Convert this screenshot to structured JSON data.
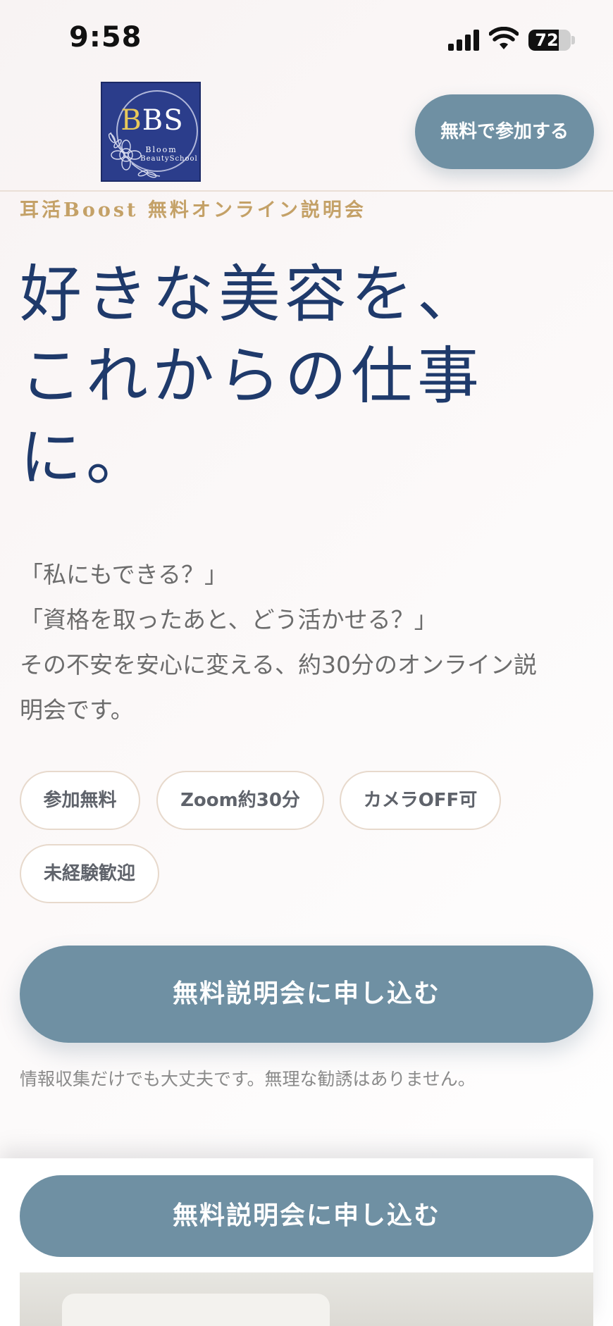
{
  "status_bar": {
    "time": "9:58",
    "battery": "72",
    "battery_level": 0.72
  },
  "header": {
    "logo": {
      "text_main": "BBS",
      "text_sub1": "Bloom",
      "text_sub2": "BeautySchool",
      "colors": {
        "background": "#2b3d8b",
        "gold": "#e8c95a"
      }
    },
    "cta_label": "無料で参加する"
  },
  "hero": {
    "eyebrow": "耳活Boost 無料オンライン説明会",
    "headline_lines": [
      "好きな美容を、",
      "これからの仕事",
      "に。"
    ],
    "intro_lines": [
      "「私にもできる？」",
      "「資格を取ったあと、どう活かせる？」",
      "その不安を安心に変える、約30分のオンライン説",
      "明会です。"
    ],
    "tags": [
      "参加無料",
      "Zoom約30分",
      "カメラOFF可",
      "未経験歓迎"
    ],
    "cta_label": "無料説明会に申し込む",
    "reassurance": "情報収集だけでも大丈夫です。無理な勧誘はありません。"
  },
  "sticky_bar": {
    "cta_label": "無料説明会に申し込む"
  },
  "colors": {
    "accent": "#6f90a3",
    "headline": "#1f3a6b",
    "eyebrow": "#c4a167",
    "tag_border": "#e7d9cc"
  }
}
